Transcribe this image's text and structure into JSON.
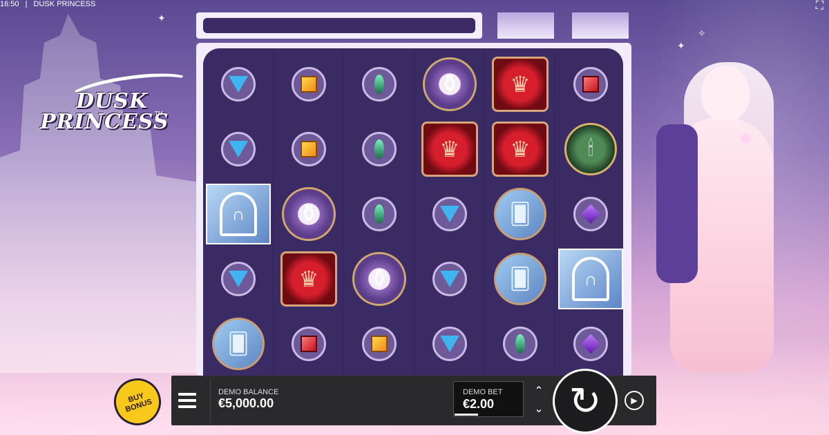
{
  "status": {
    "time": "16:50",
    "title": "DUSK PRINCESS"
  },
  "logo": {
    "line1": "DUSK",
    "line2": "PRINCESS",
    "tm": "TM"
  },
  "reels": [
    [
      "blue-gem",
      "blue-gem",
      "wild",
      "blue-gem",
      "cards"
    ],
    [
      "orange-gem",
      "orange-gem",
      "teapot",
      "crown",
      "red-gem"
    ],
    [
      "green-gem",
      "green-gem",
      "green-gem",
      "teapot",
      "orange-gem"
    ],
    [
      "teapot",
      "crown",
      "blue-gem",
      "blue-gem",
      "blue-gem"
    ],
    [
      "crown",
      "crown",
      "cards",
      "cards",
      "green-gem"
    ],
    [
      "red-gem",
      "candle",
      "purple-gem",
      "wild",
      "purple-gem"
    ]
  ],
  "controls": {
    "buy_bonus": "BUY BONUS",
    "balance_label": "DEMO BALANCE",
    "balance_value": "€5,000.00",
    "bet_label": "DEMO BET",
    "bet_value": "€2.00"
  },
  "icons": {
    "menu": "hamburger-icon",
    "spin": "spin-icon",
    "autoplay": "autoplay-icon",
    "bet_up": "chevron-up-icon",
    "bet_down": "chevron-down-icon"
  },
  "colors": {
    "buy_bonus": "#f8c91b",
    "control_bar": "#2a2a2c",
    "reel_bg": "#463570"
  }
}
